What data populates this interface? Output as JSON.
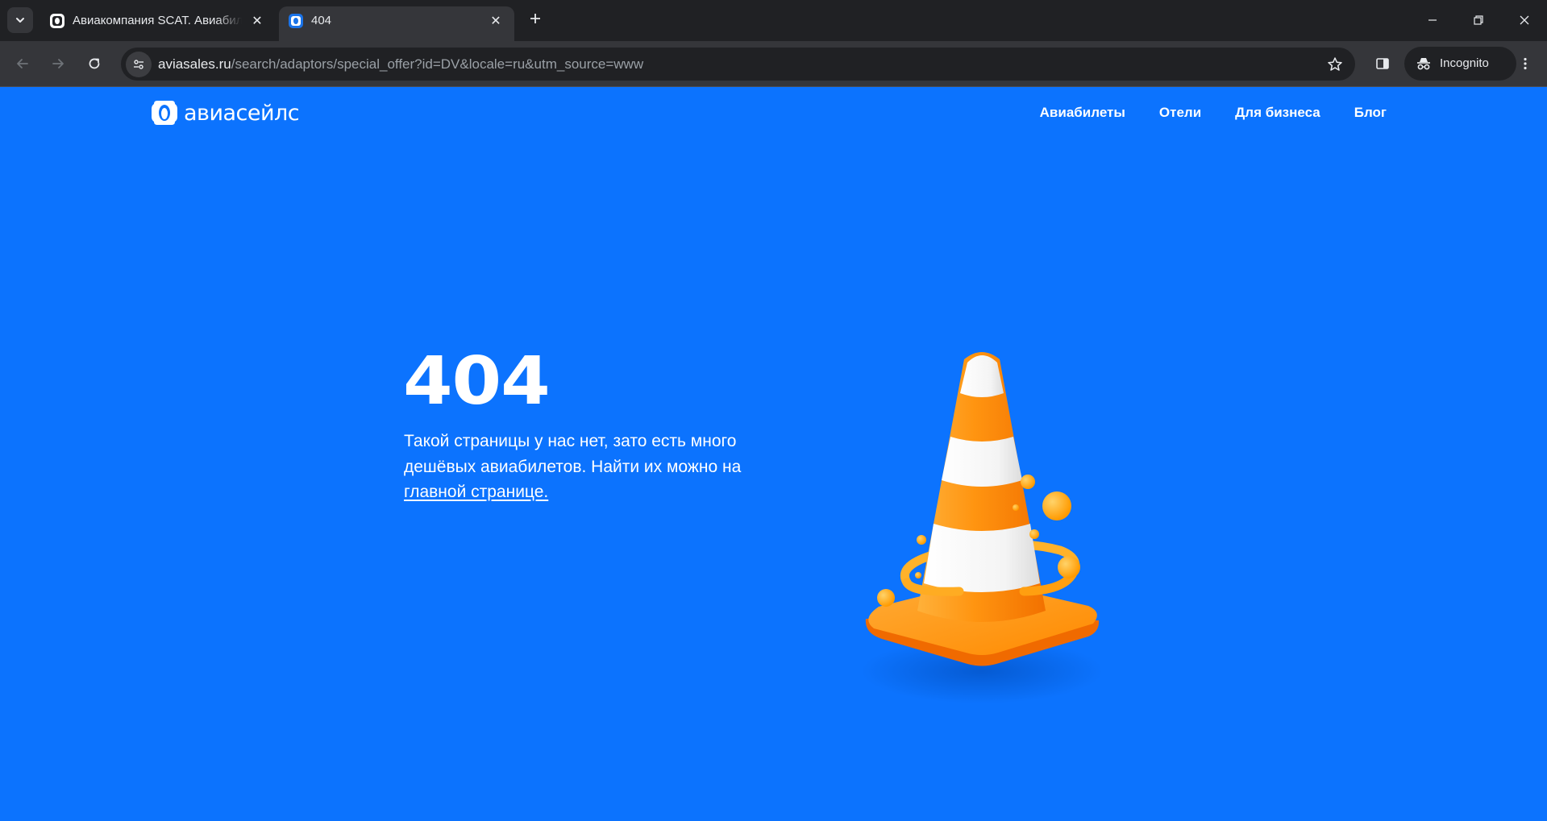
{
  "browser": {
    "tabs": [
      {
        "title": "Авиакомпания SCAT. Авиабилеты",
        "active": false
      },
      {
        "title": "404",
        "active": true
      }
    ],
    "url_host": "aviasales.ru",
    "url_path": "/search/adaptors/special_offer?id=DV&locale=ru&utm_source=www",
    "profile_label": "Incognito",
    "icons": [
      "tab-search-icon",
      "favicon-icon",
      "close-icon",
      "plus-icon",
      "minimize-icon",
      "restore-icon",
      "window-close-icon",
      "back-icon",
      "forward-icon",
      "reload-icon",
      "site-info-icon",
      "star-icon",
      "side-panel-icon",
      "incognito-icon",
      "kebab-menu-icon"
    ]
  },
  "site": {
    "logo_text": "авиасейлс",
    "nav": [
      {
        "label": "Авиабилеты"
      },
      {
        "label": "Отели"
      },
      {
        "label": "Для бизнеса"
      },
      {
        "label": "Блог"
      }
    ]
  },
  "error": {
    "code": "404",
    "message_before_link": "Такой страницы у нас нет, зато есть много дешёвых авиабилетов. Найти их можно на ",
    "link_text": "главной странице."
  },
  "colors": {
    "background": "#0c73fe",
    "chrome_dark": "#202124",
    "chrome_toolbar": "#35363a",
    "cone_orange": "#ff8a00",
    "cone_stripe": "#ffffff"
  }
}
